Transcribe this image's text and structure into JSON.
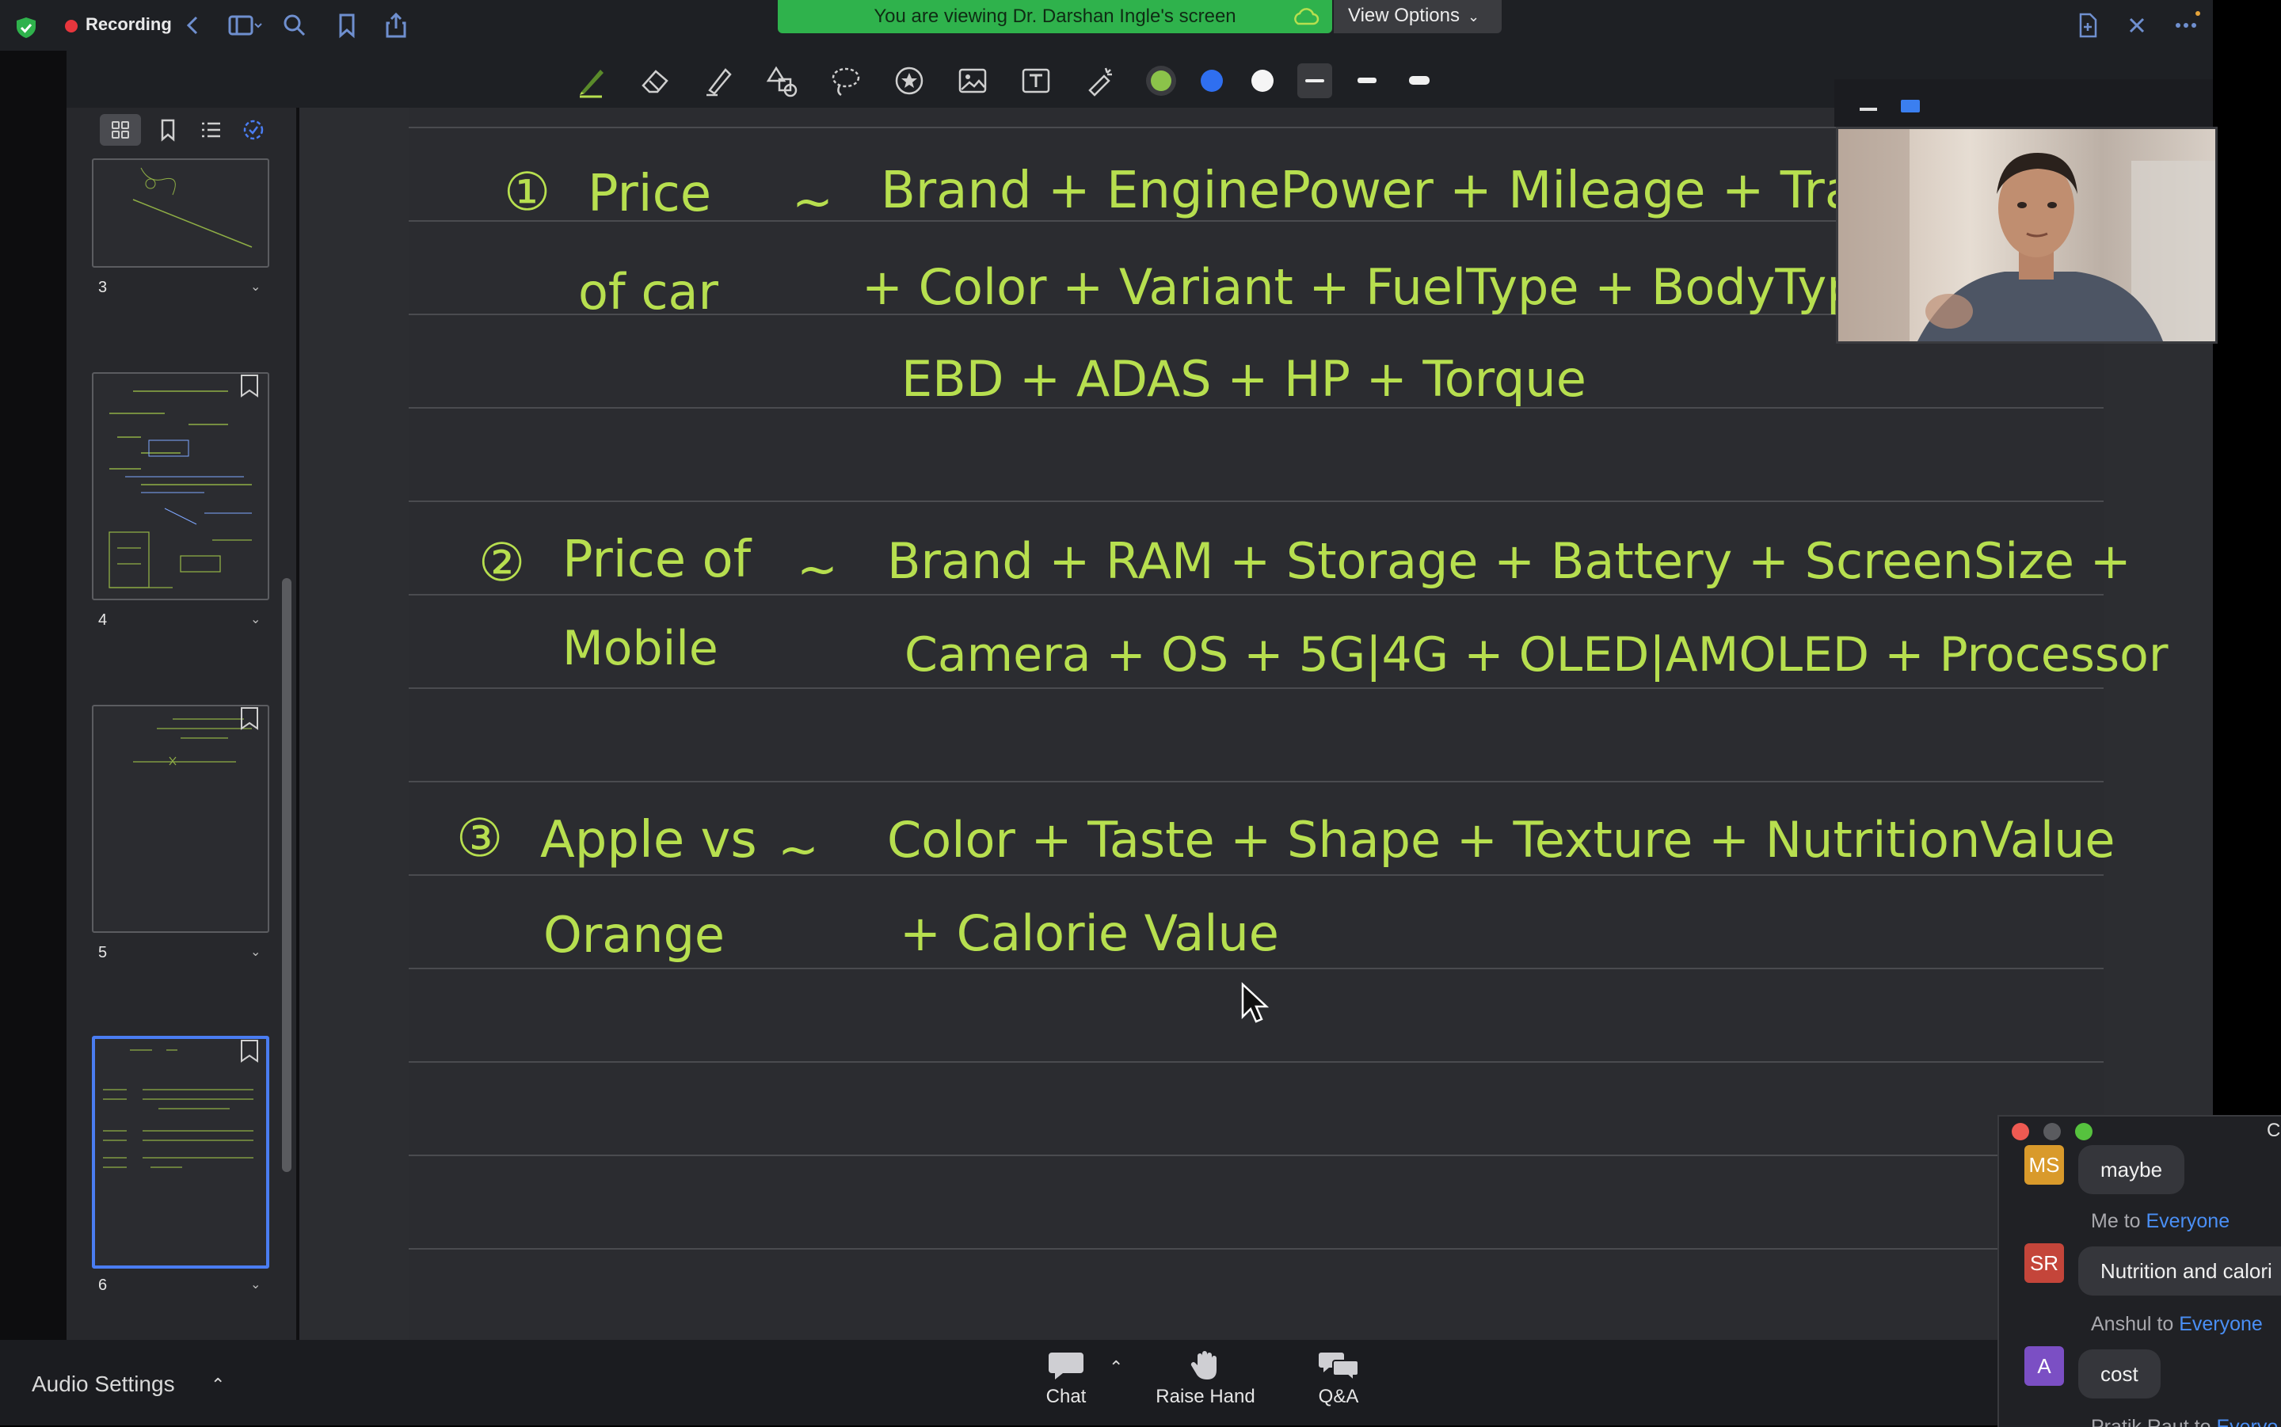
{
  "topbar": {
    "recording_label": "Recording",
    "share_banner": "You are viewing Dr. Darshan Ingle's screen",
    "view_options": "View Options"
  },
  "sidebar": {
    "pages": [
      {
        "number": "3"
      },
      {
        "number": "4"
      },
      {
        "number": "5"
      },
      {
        "number": "6"
      }
    ]
  },
  "notes": {
    "line1_no": "①",
    "line1_lhs": "Price",
    "line1_lhs2": "of car",
    "line1_tilde": "~",
    "line1_r1": "Brand + EnginePower + Mileage + Transmi",
    "line1_r2": "+ Color + Variant + FuelType + BodyType +",
    "line1_r3": "EBD + ADAS + HP + Torque",
    "line2_no": "②",
    "line2_lhs": "Price of",
    "line2_lhs2": "Mobile",
    "line2_tilde": "~",
    "line2_r1": "Brand + RAM + Storage + Battery + ScreenSize +",
    "line2_r2": "Camera + OS + 5G|4G + OLED|AMOLED + Processor",
    "line3_no": "③",
    "line3_lhs": "Apple vs",
    "line3_lhs2": "Orange",
    "line3_tilde": "~",
    "line3_r1": "Color + Taste + Shape + Texture + NutritionValue",
    "line3_r2": "+ Calorie Value"
  },
  "bottombar": {
    "audio_settings": "Audio Settings",
    "chat": "Chat",
    "raise_hand": "Raise Hand",
    "qa": "Q&A"
  },
  "chat": {
    "title_fragment": "C",
    "messages": [
      {
        "initials": "MS",
        "avatar_color": "#d99a2b",
        "text": "maybe"
      },
      {
        "from": "Me",
        "to_word": "to",
        "to": "Everyone",
        "initials": "SR",
        "avatar_color": "#c4453a",
        "text": "Nutrition and calori"
      },
      {
        "from": "Anshul",
        "to_word": "to",
        "to": "Everyone",
        "initials": "A",
        "avatar_color": "#7b4fc4",
        "text": "cost"
      },
      {
        "from": "Pratik Raut",
        "to_word": "to",
        "to": "Everyo"
      }
    ]
  },
  "colors": {
    "ink": "#b7df4f",
    "accent_blue": "#4a7df2",
    "banner_green": "#2fb24c",
    "recording_red": "#e8363d"
  }
}
